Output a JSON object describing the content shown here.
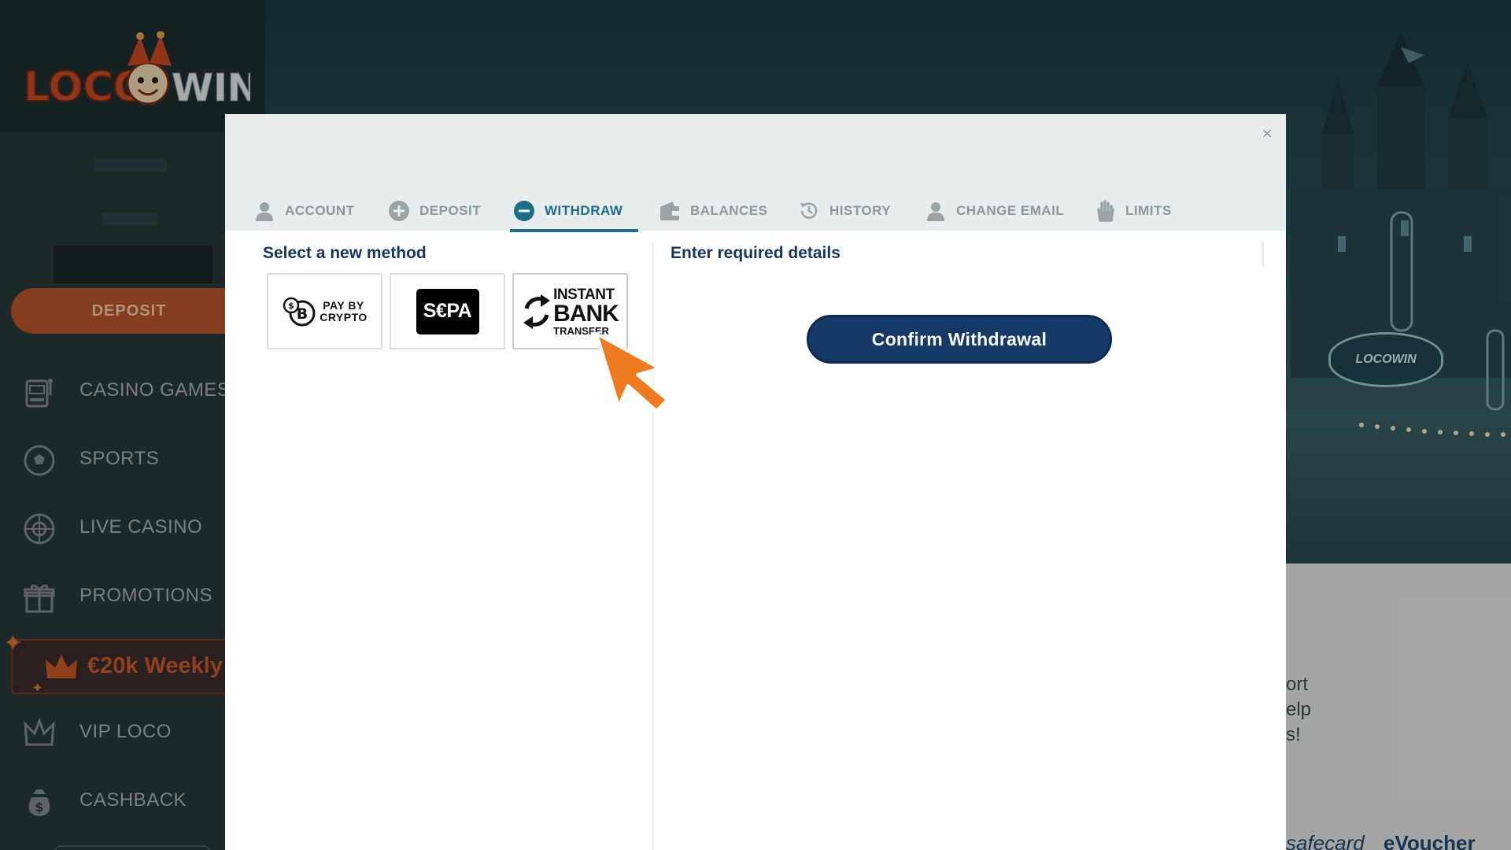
{
  "sidebar": {
    "logo_text_left": "LOCO",
    "logo_text_right": "WIN",
    "deposit_label": "DEPOSIT",
    "nav": [
      {
        "label": "CASINO GAMES",
        "icon": "slot-machine-icon"
      },
      {
        "label": "SPORTS",
        "icon": "soccer-ball-icon"
      },
      {
        "label": "LIVE CASINO",
        "icon": "roulette-icon"
      },
      {
        "label": "PROMOTIONS",
        "icon": "gift-icon"
      },
      {
        "label": "VIP LOCO",
        "icon": "jester-crown-icon"
      },
      {
        "label": "CASHBACK",
        "icon": "money-bag-icon"
      }
    ],
    "promo_banner": "€20k Weekly"
  },
  "background": {
    "welcome_sign": "LOCOWIN",
    "lower_text_lines": [
      "ort",
      "elp",
      "s!"
    ],
    "bottom_logos": [
      "safecard",
      "eVoucher"
    ]
  },
  "modal": {
    "close_label": "×",
    "tabs": [
      {
        "label": "ACCOUNT",
        "icon": "user-icon",
        "active": false
      },
      {
        "label": "DEPOSIT",
        "icon": "plus-circle-icon",
        "active": false
      },
      {
        "label": "WITHDRAW",
        "icon": "minus-circle-icon",
        "active": true
      },
      {
        "label": "BALANCES",
        "icon": "wallet-icon",
        "active": false
      },
      {
        "label": "HISTORY",
        "icon": "history-clock-icon",
        "active": false
      },
      {
        "label": "CHANGE EMAIL",
        "icon": "user-icon",
        "active": false
      },
      {
        "label": "LIMITS",
        "icon": "hand-icon",
        "active": false
      }
    ],
    "left_title": "Select a new method",
    "right_title": "Enter required details",
    "methods": {
      "crypto": {
        "line1": "PAY BY",
        "line2": "CRYPTO"
      },
      "sepa": {
        "label": "S€PA"
      },
      "instant_bank": {
        "line1": "INSTANT",
        "line2": "BANK",
        "line3": "TRANSFER"
      }
    },
    "confirm_label": "Confirm Withdrawal"
  },
  "colors": {
    "accent": "#1c6d87",
    "confirm_bg": "#163a68",
    "heading": "#15365c",
    "deposit_orange": "#b8572a",
    "arrow_orange": "#f07a1e"
  }
}
